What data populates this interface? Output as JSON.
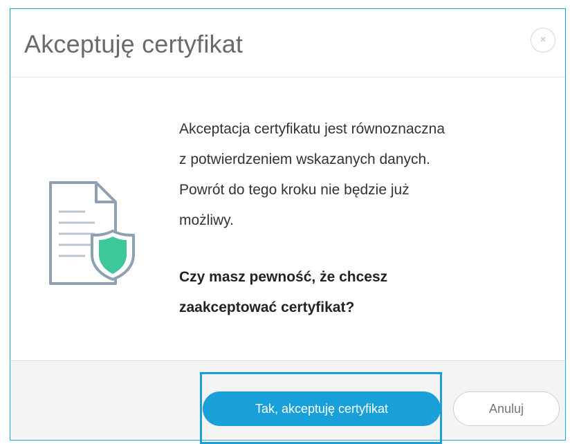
{
  "dialog": {
    "title": "Akceptuję certyfikat",
    "close_symbol": "×",
    "message_lines": [
      "Akceptacja certyfikatu jest równoznaczna",
      "z potwierdzeniem wskazanych danych.",
      "Powrót do tego kroku nie będzie już",
      "możliwy."
    ],
    "question_lines": [
      "Czy masz pewność, że chcesz",
      "zaakceptować certyfikat?"
    ],
    "icon": "document-shield-icon"
  },
  "buttons": {
    "accept_label": "Tak, akceptuję certyfikat",
    "cancel_label": "Anuluj"
  },
  "colors": {
    "accent": "#1aa0d8",
    "shield": "#3ec79a"
  }
}
